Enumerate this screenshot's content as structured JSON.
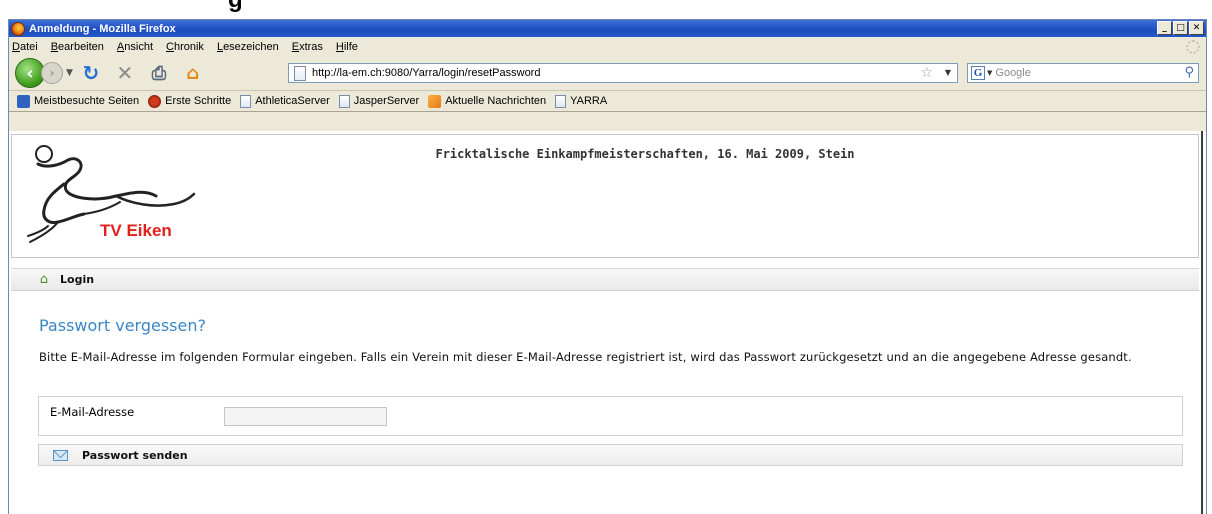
{
  "window": {
    "title": "Anmeldung - Mozilla Firefox"
  },
  "window_controls": {
    "minimize": "_",
    "maximize": "□",
    "close": "✕"
  },
  "menu": [
    "Datei",
    "Bearbeiten",
    "Ansicht",
    "Chronik",
    "Lesezeichen",
    "Extras",
    "Hilfe"
  ],
  "toolbar": {
    "url": "http://la-em.ch:9080/Yarra/login/resetPassword",
    "search_placeholder": "Google"
  },
  "bookmarks": [
    {
      "label": "Meistbesuchte Seiten",
      "icon": "most-visited-icon"
    },
    {
      "label": "Erste Schritte",
      "icon": "firefox-icon"
    },
    {
      "label": "AthleticaServer",
      "icon": "page-icon"
    },
    {
      "label": "JasperServer",
      "icon": "page-icon"
    },
    {
      "label": "Aktuelle Nachrichten",
      "icon": "rss-icon"
    },
    {
      "label": "YARRA",
      "icon": "page-icon"
    }
  ],
  "header": {
    "logo_text": "TV Eiken",
    "event_title": "Fricktalische Einkampfmeisterschaften, 16. Mai 2009, Stein"
  },
  "breadcrumb": {
    "label": "Login"
  },
  "main": {
    "heading": "Passwort vergessen?",
    "instructions": "Bitte E-Mail-Adresse im folgenden Formular eingeben. Falls ein Verein mit dieser E-Mail-Adresse registriert ist, wird das Passwort zurückgesetzt und an die angegebene Adresse gesandt.",
    "email_label": "E-Mail-Adresse",
    "email_value": "",
    "submit_label": "Passwort senden"
  },
  "colors": {
    "heading": "#3a87c8",
    "logo_text": "#e2211c",
    "titlebar": "#2457c8"
  }
}
